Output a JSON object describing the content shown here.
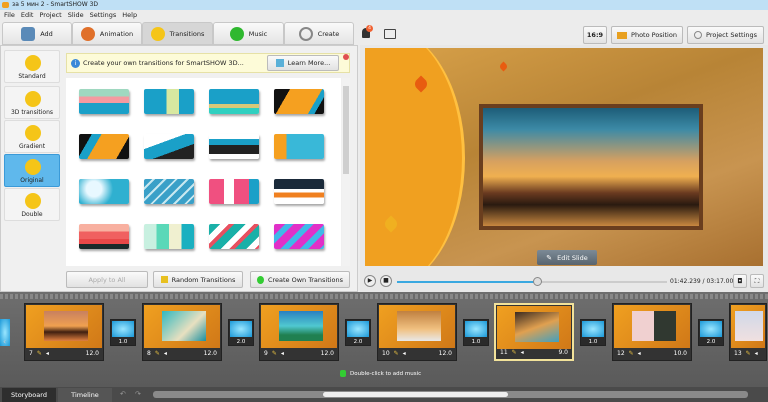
{
  "window": {
    "title": "за 5 мин 2 - SmartSHOW 3D"
  },
  "menu": [
    "File",
    "Edit",
    "Project",
    "Slide",
    "Settings",
    "Help"
  ],
  "tabs": [
    {
      "label": "Add",
      "color": "#5a8ab8"
    },
    {
      "label": "Animation",
      "color": "#e0702a"
    },
    {
      "label": "Transitions",
      "color": "#f5c518",
      "active": true
    },
    {
      "label": "Music",
      "color": "#2fb82f"
    },
    {
      "label": "Create",
      "color": "#9a9a9a"
    }
  ],
  "toolbar": {
    "notification_count": "4",
    "aspect": "16:9",
    "photo_position": "Photo Position",
    "project_settings": "Project Settings"
  },
  "categories": [
    {
      "label": "Standard"
    },
    {
      "label": "3D transitions"
    },
    {
      "label": "Gradient"
    },
    {
      "label": "Original",
      "active": true
    },
    {
      "label": "Double"
    }
  ],
  "banner": {
    "text": "Create your own transitions for SmartSHOW 3D...",
    "learn_more": "Learn More..."
  },
  "transition_tiles": [
    "linear-gradient(#9fd8c0 0 30%,#f49aa0 30% 55%,#1aa0c8 55%)",
    "linear-gradient(90deg,#1aa0c8 0 45%,#d8e8a0 45% 70%,#1aa0c8 70%)",
    "linear-gradient(#1aa0c8 0 60%,#d8c878 60% 75%,#30d0c0 75%)",
    "linear-gradient(120deg,#111 0 25%,#f5a020 25% 75%,#1aa0c8 75% 85%,#111 85%)",
    "linear-gradient(120deg,#111 0 20%,#1aa0c8 20% 35%,#f5a020 35% 80%,#111 80%)",
    "linear-gradient(160deg,#fff 0 35%,#1aa0c8 35% 65%,#222 65%)",
    "linear-gradient(#fff 0 20%,#1aa0c8 20% 45%,#222 45% 80%,#fff 80%)",
    "linear-gradient(90deg,#f5a020 0 25%,#39b8d8 25%)",
    "radial-gradient(circle at 30% 40%,#e8f8ff 0 20%,#2fb0d0 50%)",
    "repeating-linear-gradient(135deg,#3aa0c8 0 6px,#c8e8f0 6px 8px)",
    "linear-gradient(90deg,#f05080 0 30%,#fff 30% 50%,#f05080 50% 80%,#1aa0c8 80%)",
    "linear-gradient(#1a2a3a 0 40%,#fff 40% 55%,#f08020 55% 75%,#fff 75%)",
    "linear-gradient(#f8b0a0 0 30%,#f06060 30% 60%,#e84848 60% 80%,#1a2a2a 80%)",
    "linear-gradient(90deg,#c8f0e0 0 25%,#5ad8b8 25% 50%,#f0f0d0 50% 75%,#1ab0c0 75%)",
    "repeating-linear-gradient(135deg,#1ab0a8 0 8px,#fff 8px 14px,#e85060 14px 18px)",
    "repeating-linear-gradient(135deg,#e030c8 0 8px,#40b8e8 8px 14px)"
  ],
  "panel_buttons": {
    "apply_all": "Apply to All",
    "random": "Random Transitions",
    "create_own": "Create Own Transitions"
  },
  "preview": {
    "edit_slide": "Edit Slide",
    "time": "01:42.239 / 03:17.000",
    "progress_fraction": 0.52
  },
  "slides": [
    {
      "num": "7",
      "duration": "12.0",
      "pic": "linear-gradient(#c88060,#f0a050 50%,#402010 70%,#e08040)"
    },
    {
      "num": "8",
      "duration": "12.0",
      "pic": "linear-gradient(135deg,#30b8c0,#e8e0c0 60%,#1a90a0)"
    },
    {
      "num": "9",
      "duration": "12.0",
      "pic": "linear-gradient(#2a80c0,#50c8d0 50%,#208050 80%)"
    },
    {
      "num": "10",
      "duration": "12.0",
      "pic": "linear-gradient(#c08040,#f0c080 60%,#e8e8e8)"
    },
    {
      "num": "11",
      "duration": "9.0",
      "selected": true,
      "pic": "linear-gradient(160deg,#3a2a20,#e0a050 50%,#40a0c0)"
    },
    {
      "num": "12",
      "duration": "10.0",
      "pic": "linear-gradient(90deg,#f0d0d0 0 50%,#303830 50%)"
    },
    {
      "num": "13",
      "duration": "",
      "pic": "linear-gradient(#d0d8e8,#f0e0e0)"
    }
  ],
  "slide_transitions": [
    "1.0",
    "2.0",
    "2.0",
    "1.0",
    "1.0",
    "2.0"
  ],
  "storyboard": {
    "music_hint": "Double-click to add music"
  },
  "bottom_tabs": {
    "storyboard": "Storyboard",
    "timeline": "Timeline"
  }
}
